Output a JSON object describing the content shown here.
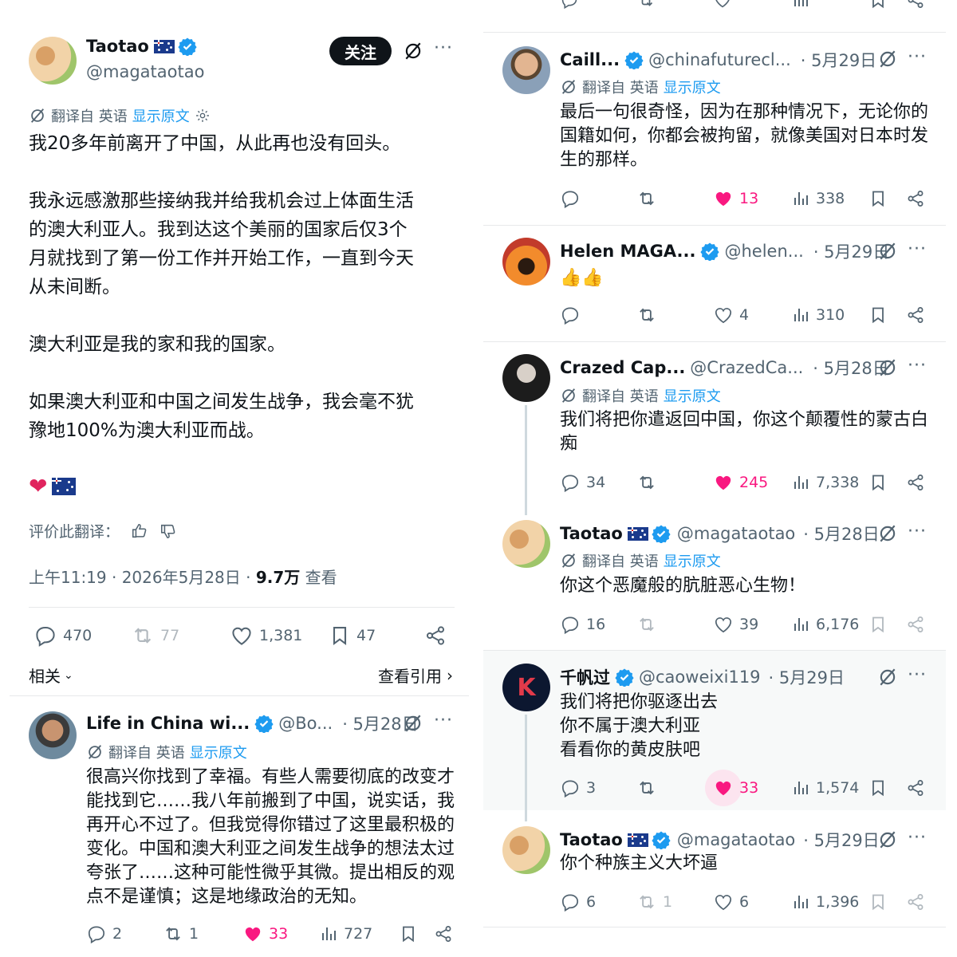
{
  "main_post": {
    "author_name": "Taotao",
    "author_handle": "@magataotao",
    "follow_label": "关注",
    "translated_from": "翻译自 英语",
    "show_original": "显示原文",
    "paragraphs": [
      "我20多年前离开了中国，从此再也没有回头。",
      "我永远感激那些接纳我并给我机会过上体面生活",
      "的澳大利亚人。我到达这个美丽的国家后仅3个",
      "月就找到了第一份工作并开始工作，一直到今天",
      "从未间断。",
      "澳大利亚是我的家和我的国家。",
      "如果澳大利亚和中国之间发生战争，我会毫不犹",
      "豫地100%为澳大利亚而战。"
    ],
    "rate_translation": "评价此翻译：",
    "timestamp": "上午11:19 · 2026年5月28日 · ",
    "views_count": "9.7万",
    "views_label": " 查看",
    "stats": {
      "replies": "470",
      "reposts": "77",
      "likes": "1,381",
      "bookmarks": "47"
    },
    "related_label": "相关",
    "quotes_label": "查看引用"
  },
  "left_reply": {
    "author_name": "Life in China wi...",
    "author_handle": "@Bo...",
    "date": "· 5月28日",
    "translated_from": "翻译自 英语",
    "show_original": "显示原文",
    "lines": [
      "很高兴你找到了幸福。有些人需要彻底的改变才",
      "能找到它……我八年前搬到了中国，说实话，我",
      "再开心不过了。但我觉得你错过了这里最积极的",
      "变化。中国和澳大利亚之间发生战争的想法太过",
      "夸张了……这种可能性微乎其微。提出相反的观",
      "点不是谨慎；这是地缘政治的无知。"
    ],
    "stats": {
      "replies": "2",
      "reposts": "1",
      "likes": "33",
      "views": "727"
    }
  },
  "right_replies": [
    {
      "author_name": "Caill...",
      "author_handle": "@chinafuturecl...",
      "date": "· 5月29日",
      "translated_from": "翻译自 英语",
      "show_original": "显示原文",
      "lines": [
        "最后一句很奇怪，因为在那种情况下，无论你的",
        "国籍如何，你都会被拘留，就像美国对日本时发",
        "生的那样。"
      ],
      "stats": {
        "replies": "",
        "reposts": "",
        "likes": "13",
        "views": "338"
      }
    },
    {
      "author_name": "Helen MAGA...",
      "author_handle": "@helen...",
      "date": "· 5月29日",
      "lines": [
        "👍👍"
      ],
      "stats": {
        "replies": "",
        "reposts": "",
        "likes": "4",
        "views": "310"
      }
    },
    {
      "author_name": "Crazed Cap...",
      "author_handle": "@CrazedCa...",
      "date": "· 5月28日",
      "translated_from": "翻译自 英语",
      "show_original": "显示原文",
      "lines": [
        "我们将把你遣返回中国，你这个颠覆性的蒙古白",
        "痴"
      ],
      "stats": {
        "replies": "34",
        "reposts": "",
        "likes": "245",
        "views": "7,338"
      }
    },
    {
      "author_name": "Taotao",
      "author_handle": "@magataotao",
      "date": "· 5月28日",
      "translated_from": "翻译自 英语",
      "show_original": "显示原文",
      "lines": [
        "你这个恶魔般的肮脏恶心生物！"
      ],
      "stats": {
        "replies": "16",
        "reposts": "",
        "likes": "39",
        "views": "6,176"
      }
    },
    {
      "author_name": "千帆过",
      "author_handle": "@caoweixi119",
      "date": "· 5月29日",
      "lines": [
        "我们将把你驱逐出去",
        "你不属于澳大利亚",
        "看看你的黄皮肤吧"
      ],
      "stats": {
        "replies": "3",
        "reposts": "",
        "likes": "33",
        "views": "1,574"
      }
    },
    {
      "author_name": "Taotao",
      "author_handle": "@magataotao",
      "date": "· 5月29日",
      "lines": [
        "你个种族主义大坏逼"
      ],
      "stats": {
        "replies": "6",
        "reposts": "1",
        "likes": "6",
        "views": "1,396"
      }
    }
  ],
  "colors": {
    "accent": "#1d9bf0",
    "like": "#f91880",
    "text": "#0f1419",
    "muted": "#536471"
  }
}
